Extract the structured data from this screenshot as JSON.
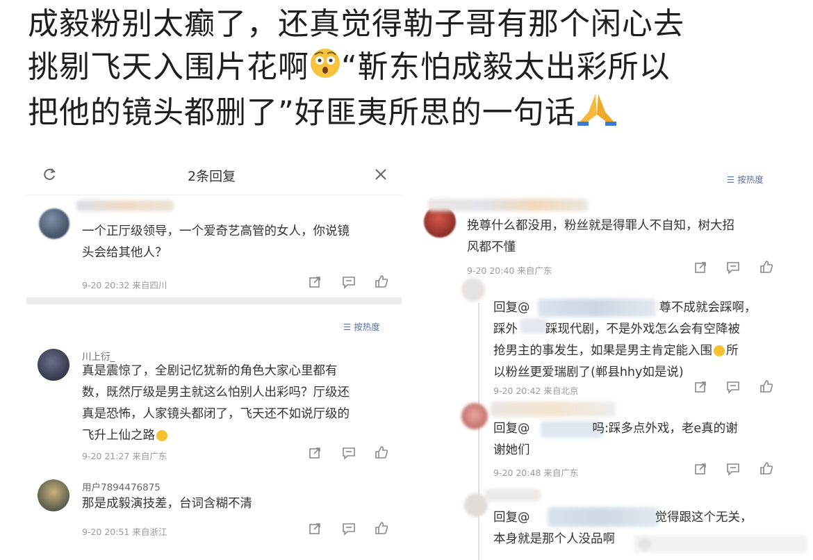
{
  "headline": {
    "line1": "成毅粉别太癫了，还真觉得勒子哥有那个闲心去",
    "line2_pre": "挑剔飞天入围片花啊",
    "line2_post": "“靳东怕成毅太出彩所以",
    "line3_pre": "把他的镜头都删了”好匪夷所思的一句话",
    "emoji1": "shocked-face",
    "emoji2": "folded-hands"
  },
  "left_panel": {
    "title": "2条回复",
    "sort_label": "按热度",
    "comments": [
      {
        "user": "",
        "text_l1": "一个正厅级领导，一个爱奇艺高管的女人，你说镜",
        "text_l2": "头会给其他人？",
        "meta": "9-20 20:32 来自四川"
      },
      {
        "user": "川上衍_",
        "text_l1": "真是震惊了，全剧记忆犹新的角色大家心里都有",
        "text_l2": "数，既然厅级是男主就这么怕别人出彩吗？厅级还",
        "text_l3": "真是恐怖，人家镜头都闭了，飞天还不如说厅级的",
        "text_l4": "飞升上仙之路",
        "meta": "9-20 21:27 来自广东"
      },
      {
        "user": "用户7894476875",
        "text_l1": "那是成毅演技差，台词含糊不清",
        "meta": "9-20 20:51 来自浙江"
      }
    ]
  },
  "right_panel": {
    "sort_label": "按热度",
    "comments": [
      {
        "text_l1": "挽尊什么都没用，粉丝就是得罪人不自知，树大招",
        "text_l2": "风都不懂",
        "meta": "9-20 20:40 来自广东"
      },
      {
        "text_l1a": "回复@",
        "text_l1b": "尊不成就会踩啊，",
        "text_l2a": "踩外",
        "text_l2b": "踩现代剧，不是外戏怎么会有空降被",
        "text_l3": "抢男主的事发生，如果是男主肯定能入围",
        "text_l3b": "所",
        "text_l4": "以粉丝更爱瑞剧了(郸县hhy如是说)",
        "meta": "9-20 20:42 来自北京"
      },
      {
        "text_l1a": "回复@",
        "text_l1b": "吗:踩多点外戏，老e真的谢",
        "text_l2": "谢她们",
        "meta": "9-20 20:48 来自广东"
      },
      {
        "text_l1a": "回复@",
        "text_l1b": "觉得跟这个无关，",
        "text_l2": "本身就是那个人没品啊"
      }
    ]
  }
}
